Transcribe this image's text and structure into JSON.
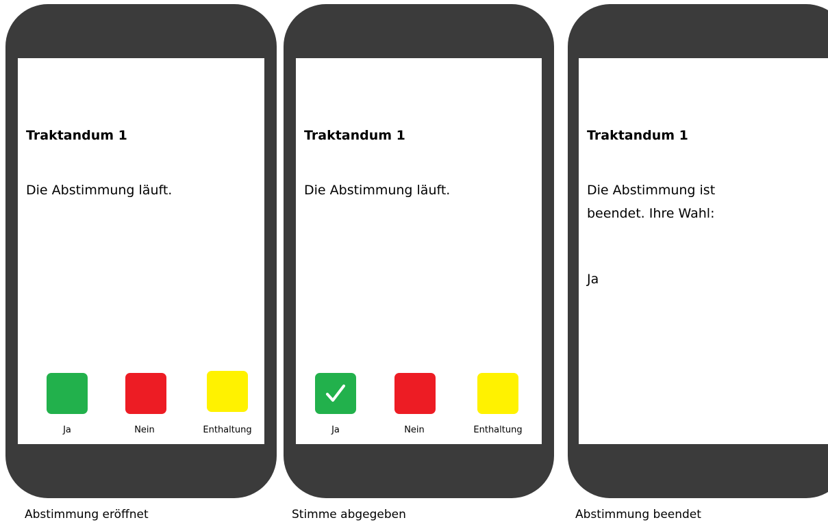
{
  "panels": [
    {
      "caption": "Abstimmung eröffnet",
      "title": "Traktandum 1",
      "status": "Die Abstimmung läuft.",
      "buttons": [
        {
          "label": "Ja",
          "color": "#22b14c",
          "checked": false
        },
        {
          "label": "Nein",
          "color": "#ed1c24",
          "checked": false
        },
        {
          "label": "Enthaltung",
          "color": "#fff200",
          "checked": false
        }
      ]
    },
    {
      "caption": "Stimme abgegeben",
      "title": "Traktandum 1",
      "status": "Die Abstimmung läuft.",
      "buttons": [
        {
          "label": "Ja",
          "color": "#22b14c",
          "checked": true,
          "icon": "checkmark-icon"
        },
        {
          "label": "Nein",
          "color": "#ed1c24",
          "checked": false
        },
        {
          "label": "Enthaltung",
          "color": "#fff200",
          "checked": false
        }
      ]
    },
    {
      "caption": "Abstimmung beendet",
      "title": "Traktandum 1",
      "status_line1": "Die Abstimmung ist",
      "status_line2": "beendet. Ihre Wahl:",
      "choice": "Ja"
    }
  ],
  "colors": {
    "phone_frame": "#3b3b3b",
    "screen": "#ffffff"
  }
}
